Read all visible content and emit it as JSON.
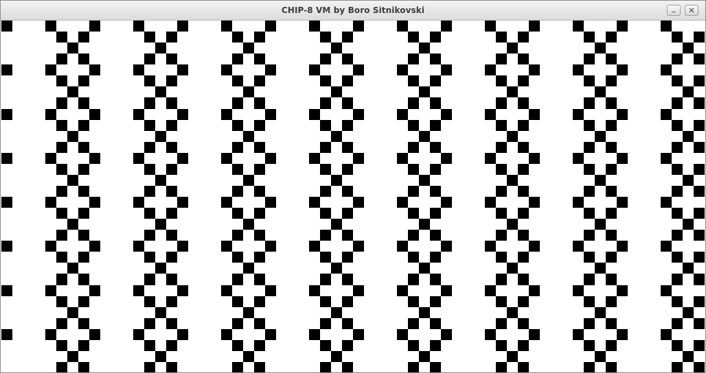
{
  "window": {
    "title": "CHIP-8 VM by Boro Sitnikovski",
    "buttons": {
      "minimize": {
        "icon": "minimize-icon"
      },
      "close": {
        "icon": "close-icon"
      }
    }
  },
  "display": {
    "cols": 64,
    "rows": 32,
    "pixel_on_color": "#000000",
    "pixel_off_color": "#ffffff"
  }
}
